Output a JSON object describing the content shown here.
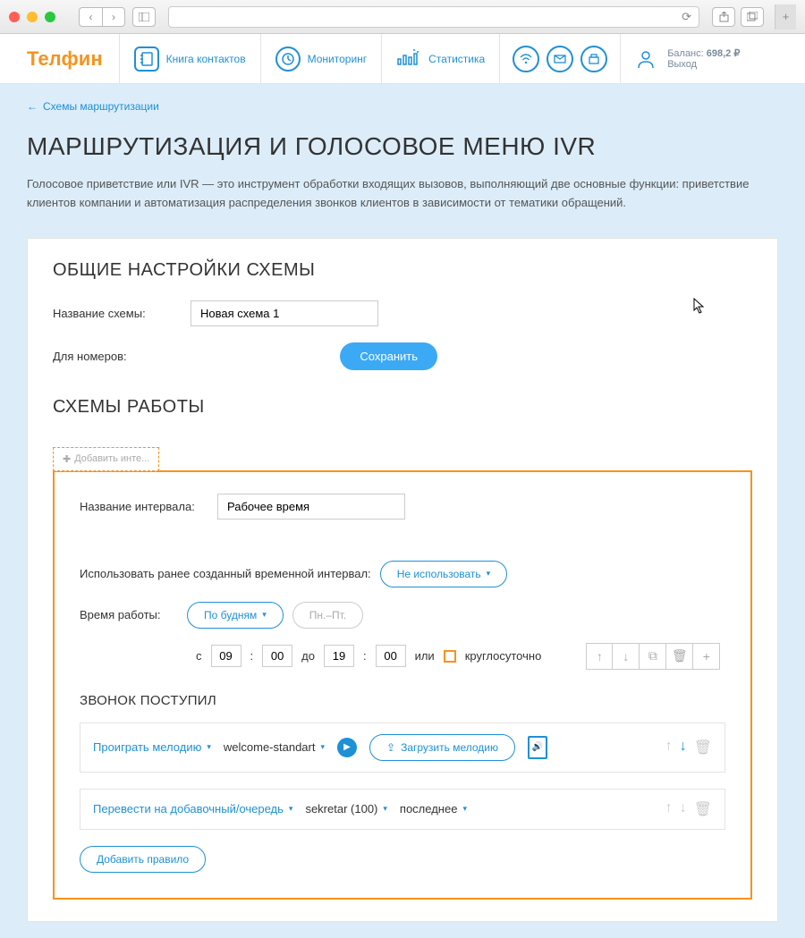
{
  "nav": {
    "contacts": "Книга контактов",
    "monitoring": "Мониторинг",
    "statistics": "Статистика"
  },
  "account": {
    "balance_label": "Баланс:",
    "balance_value": "698,2 ₽",
    "logout": "Выход"
  },
  "breadcrumb": "Схемы маршрутизации",
  "title": "МАРШРУТИЗАЦИЯ И ГОЛОСОВОЕ МЕНЮ IVR",
  "description": "Голосовое приветствие или IVR — это инструмент обработки входящих вызовов, выполняющий две основные функции: приветствие клиентов компании и автоматизация распределения звонков клиентов в зависимости от тематики обращений.",
  "general": {
    "heading": "ОБЩИЕ НАСТРОЙКИ СХЕМЫ",
    "scheme_name_label": "Название схемы:",
    "scheme_name_value": "Новая схема 1",
    "for_numbers_label": "Для номеров:",
    "save": "Сохранить"
  },
  "schedules": {
    "heading": "СХЕМЫ РАБОТЫ",
    "add_interval": "Добавить инте...",
    "interval_name_label": "Название интервала:",
    "interval_name_value": "Рабочее время",
    "use_existing_label": "Использовать ранее созданный временной интервал:",
    "use_existing_value": "Не использовать",
    "work_time_label": "Время работы:",
    "weekdays_dropdown": "По будням",
    "days_range": "Пн.–Пт.",
    "from_label": "с",
    "from_hour": "09",
    "from_min": "00",
    "to_label": "до",
    "to_hour": "19",
    "to_min": "00",
    "or_label": "или",
    "all_day": "круглосуточно"
  },
  "call": {
    "heading": "ЗВОНОК ПОСТУПИЛ",
    "rule1_action": "Проиграть мелодию",
    "rule1_melody": "welcome-standart",
    "upload": "Загрузить мелодию",
    "rule2_action": "Перевести на добавочный/очередь",
    "rule2_target": "sekretar (100)",
    "rule2_mode": "последнее",
    "add_rule": "Добавить правило"
  }
}
